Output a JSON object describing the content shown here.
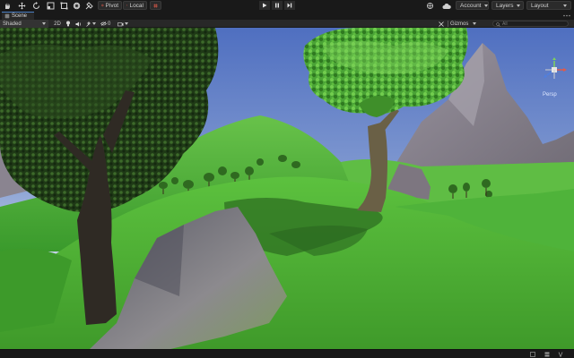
{
  "toolbar": {
    "tools": [
      "hand-tool",
      "move-tool",
      "rotate-tool",
      "scale-tool",
      "rect-tool",
      "transform-tool",
      "custom-editor-tool"
    ],
    "pivot_label": "Pivot",
    "local_label": "Local",
    "account_label": "Account",
    "layers_label": "Layers",
    "layout_label": "Layout"
  },
  "tab": {
    "scene_label": "Scene"
  },
  "scene_controls": {
    "shading_mode": "Shaded",
    "mode_2d_label": "2D",
    "hidden_count": "0",
    "gizmos_label": "Gizmos",
    "search_placeholder": "All"
  },
  "viewport": {
    "projection_label": "Persp"
  },
  "colors": {
    "editor_bg": "#191919",
    "panel_bg": "#282828",
    "accent": "#4b7ec2",
    "sky_top": "#4f6fc0",
    "sky_horizon": "#c9d6ea",
    "grass": "#4fb33a",
    "rock": "#8e8690"
  }
}
